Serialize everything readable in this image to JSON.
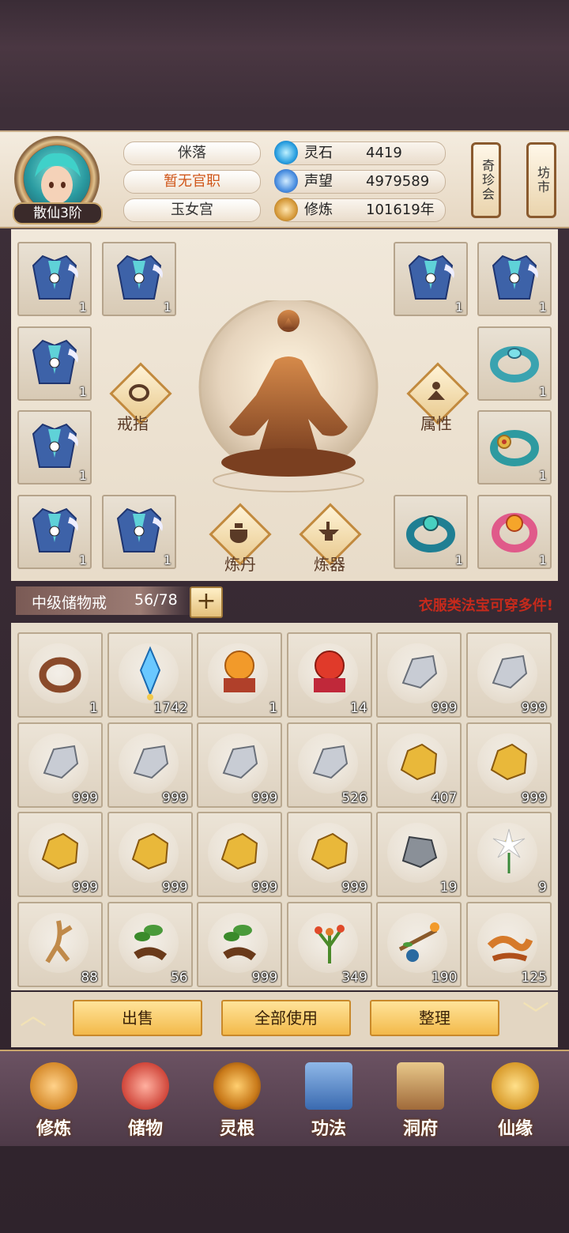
{
  "player": {
    "name": "侎落",
    "official_post": "暂无官职",
    "sect": "玉女宫",
    "rank": "散仙3阶"
  },
  "resources": [
    {
      "label": "灵石",
      "value": "4419",
      "icon": "spirit-stone-icon"
    },
    {
      "label": "声望",
      "value": "4979589",
      "icon": "prestige-icon"
    },
    {
      "label": "修炼",
      "value": "101619年",
      "icon": "cultivation-icon"
    }
  ],
  "shortcuts": {
    "treasure_fair": "奇珍会",
    "market": "坊市"
  },
  "equipment": {
    "center_actions": {
      "ring": "戒指",
      "attributes": "属性",
      "alchemy": "炼丹",
      "refining": "炼器"
    },
    "left_slots": [
      "1",
      "1",
      "1",
      "1",
      "1",
      "1"
    ],
    "right_slots": [
      "1",
      "1",
      "1",
      "1",
      "1",
      "1"
    ]
  },
  "bag": {
    "title": "中级储物戒",
    "capacity": "56/78",
    "expand_label": "+",
    "hint": "衣服类法宝可穿多件!"
  },
  "inventory": [
    {
      "icon": "ring-icon",
      "count": "1"
    },
    {
      "icon": "blue-crystal-icon",
      "count": "1742"
    },
    {
      "icon": "orange-orb-icon",
      "count": "1"
    },
    {
      "icon": "red-orb-icon",
      "count": "14"
    },
    {
      "icon": "silver-ore-icon",
      "count": "999"
    },
    {
      "icon": "silver-ore-icon",
      "count": "999"
    },
    {
      "icon": "silver-ore-icon",
      "count": "999"
    },
    {
      "icon": "silver-ore-icon",
      "count": "999"
    },
    {
      "icon": "silver-ore-icon",
      "count": "999"
    },
    {
      "icon": "silver-ore-icon",
      "count": "526"
    },
    {
      "icon": "gold-ore-icon",
      "count": "407"
    },
    {
      "icon": "gold-ore-icon",
      "count": "999"
    },
    {
      "icon": "gold-ore-icon",
      "count": "999"
    },
    {
      "icon": "gold-ore-icon",
      "count": "999"
    },
    {
      "icon": "gold-ore-icon",
      "count": "999"
    },
    {
      "icon": "gold-ore-icon",
      "count": "999"
    },
    {
      "icon": "dark-stone-icon",
      "count": "19"
    },
    {
      "icon": "white-flower-icon",
      "count": "9"
    },
    {
      "icon": "ginseng-icon",
      "count": "88"
    },
    {
      "icon": "herb-root-icon",
      "count": "56"
    },
    {
      "icon": "herb-root-icon",
      "count": "999"
    },
    {
      "icon": "red-berry-herb-icon",
      "count": "349"
    },
    {
      "icon": "branch-fruit-icon",
      "count": "190"
    },
    {
      "icon": "cordyceps-icon",
      "count": "125"
    }
  ],
  "actions": {
    "sell": "出售",
    "use_all": "全部使用",
    "sort": "整理"
  },
  "nav": [
    {
      "label": "修炼",
      "icon": "monk-icon"
    },
    {
      "label": "储物",
      "icon": "bag-icon"
    },
    {
      "label": "灵根",
      "icon": "spirit-root-icon"
    },
    {
      "label": "功法",
      "icon": "book-icon"
    },
    {
      "label": "洞府",
      "icon": "mansion-icon"
    },
    {
      "label": "仙缘",
      "icon": "gourd-icon"
    }
  ],
  "colors": {
    "accent_gold": "#f3b94a",
    "hint_red": "#c62a1c",
    "official_orange": "#d0571b"
  }
}
